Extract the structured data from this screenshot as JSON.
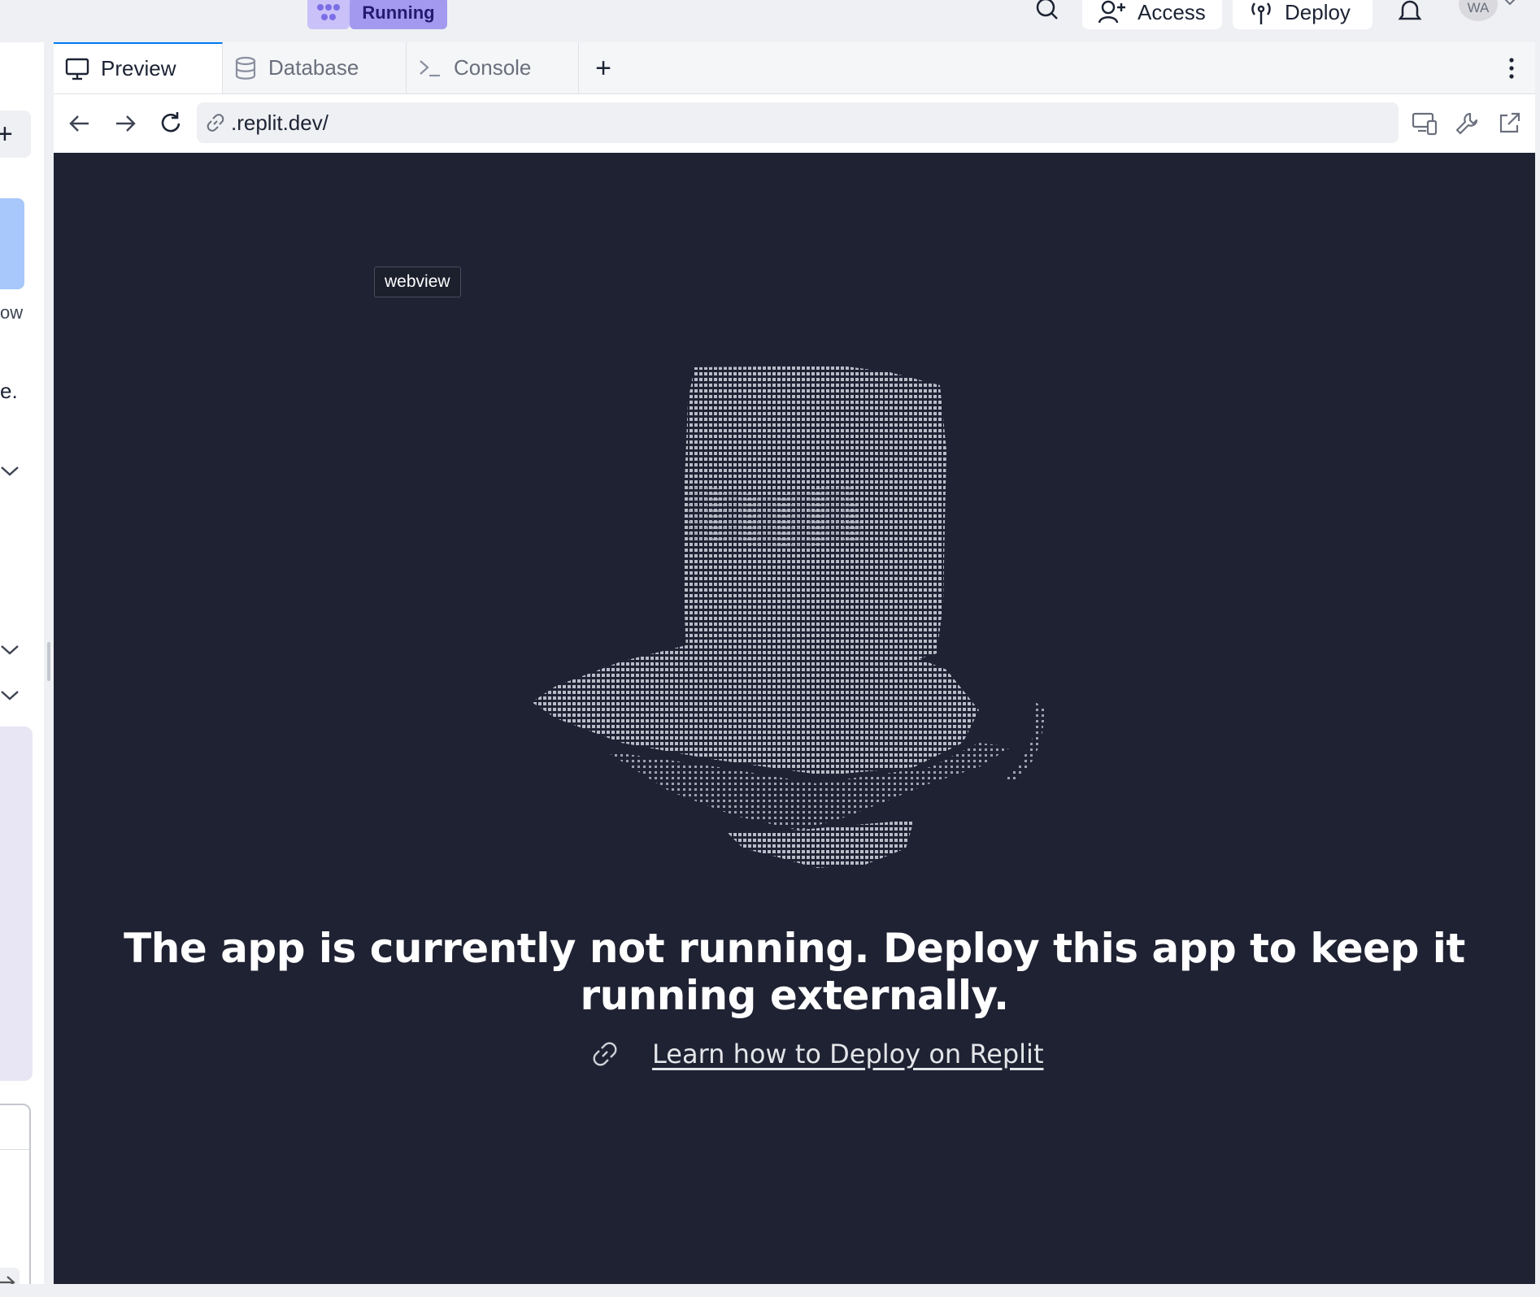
{
  "topbar": {
    "run_label": "Running",
    "access_label": "Access",
    "deploy_label": "Deploy",
    "avatar_initials": "WA"
  },
  "left_panel": {
    "text_fragment_1": "ow",
    "text_fragment_2": "e."
  },
  "tabs": [
    {
      "label": "Preview",
      "icon": "monitor-icon",
      "active": true
    },
    {
      "label": "Database",
      "icon": "database-icon",
      "active": false
    },
    {
      "label": "Console",
      "icon": "terminal-icon",
      "active": false
    }
  ],
  "address_bar": {
    "url": ".replit.dev/"
  },
  "webview": {
    "tooltip": "webview",
    "headline": "The app is currently not running. Deploy this app to keep it running externally.",
    "learn_link": "Learn how to Deploy on Replit"
  },
  "colors": {
    "accent": "#0079f2",
    "run_button": "#a39af0",
    "webview_bg": "#1f2233"
  }
}
